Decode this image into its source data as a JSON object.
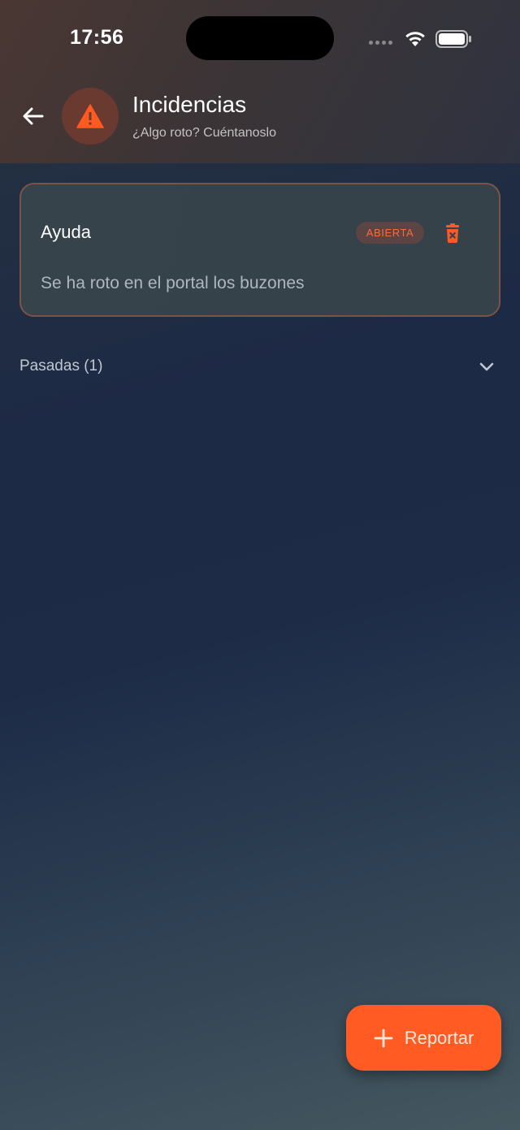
{
  "status_bar": {
    "time": "17:56"
  },
  "header": {
    "title": "Incidencias",
    "subtitle": "¿Algo roto? Cuéntanoslo",
    "back_icon": "arrow-left-icon",
    "header_icon": "warning-triangle-icon"
  },
  "incidents": [
    {
      "title": "Ayuda",
      "status": "ABIERTA",
      "description": "Se ha roto en el portal los buzones",
      "delete_icon": "trash-icon"
    }
  ],
  "past_section": {
    "label": "Pasadas (1)",
    "icon": "chevron-down-icon"
  },
  "fab": {
    "label": "Reportar",
    "icon": "plus-icon"
  },
  "colors": {
    "accent": "#ff5b22",
    "badge_text": "#ff6a3a",
    "card_border": "#7c5446"
  }
}
